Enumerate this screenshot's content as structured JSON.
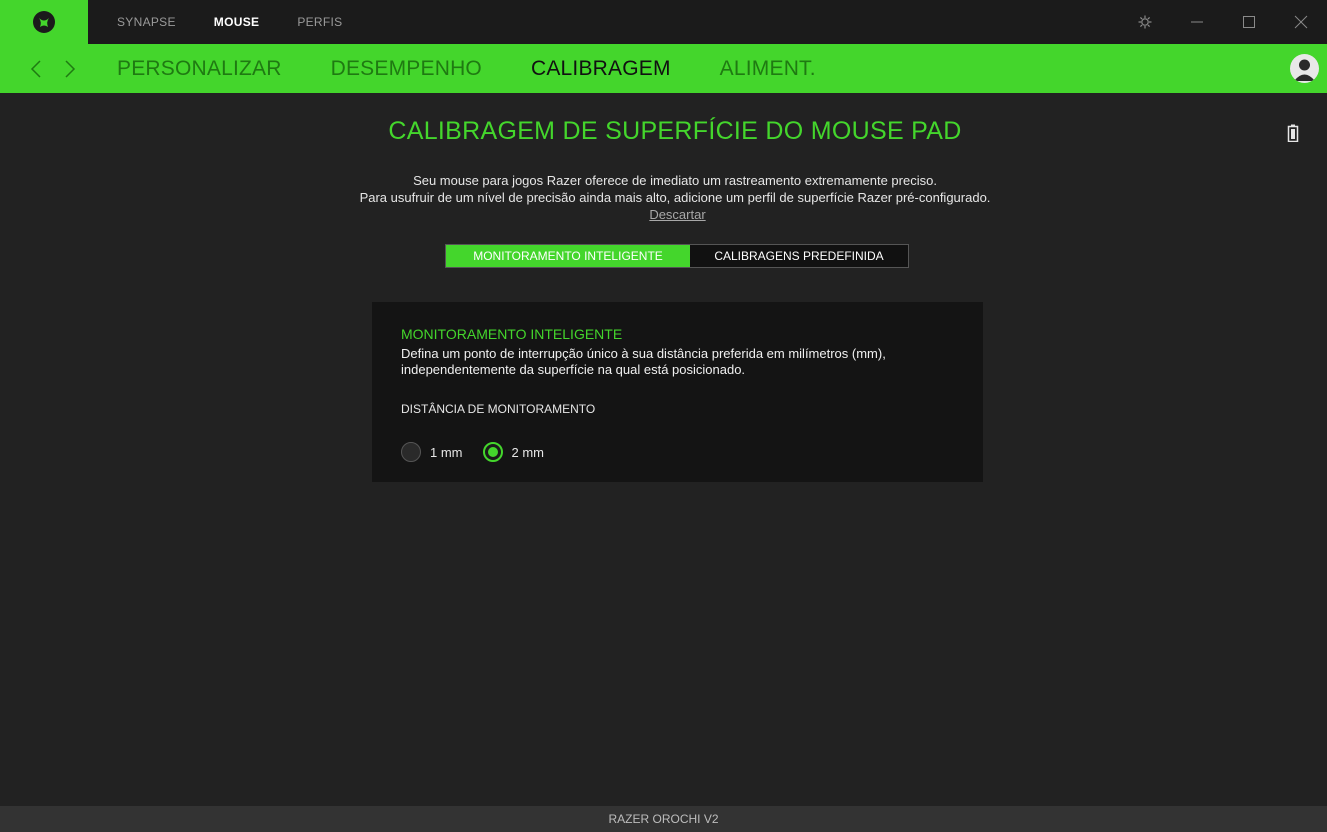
{
  "titlebar": {
    "tabs": [
      {
        "label": "SYNAPSE",
        "active": false
      },
      {
        "label": "MOUSE",
        "active": true
      },
      {
        "label": "PERFIS",
        "active": false
      }
    ],
    "icons": [
      "razer-logo-icon",
      "settings-icon",
      "minimize-icon",
      "maximize-icon",
      "close-icon"
    ]
  },
  "navbar": {
    "tabs": [
      {
        "label": "PERSONALIZAR",
        "active": false
      },
      {
        "label": "DESEMPENHO",
        "active": false
      },
      {
        "label": "CALIBRAGEM",
        "active": true
      },
      {
        "label": "ALIMENT.",
        "active": false
      }
    ]
  },
  "main": {
    "title": "CALIBRAGEM DE SUPERFÍCIE DO MOUSE PAD",
    "description_line1": "Seu mouse para jogos Razer oferece de imediato um rastreamento extremamente preciso.",
    "description_line2": "Para usufruir de um nível de precisão ainda mais alto, adicione um perfil de superfície Razer pré-configurado.",
    "dismiss_link": "Descartar",
    "mode_toggle": {
      "selected": "MONITORAMENTO INTELIGENTE",
      "options": [
        "MONITORAMENTO INTELIGENTE",
        "CALIBRAGENS PREDEFINIDA"
      ]
    },
    "panel": {
      "title": "MONITORAMENTO INTELIGENTE",
      "description": "Defina um ponto de interrupção único à sua distância preferida em milímetros (mm), independentemente da superfície na qual está posicionado.",
      "distance_label": "DISTÂNCIA DE MONITORAMENTO",
      "options": [
        {
          "label": "1 mm",
          "selected": false
        },
        {
          "label": "2 mm",
          "selected": true
        }
      ]
    }
  },
  "footer": {
    "device_name": "RAZER OROCHI V2"
  },
  "colors": {
    "accent": "#44d62c",
    "background": "#222222",
    "titlebar": "#1b1b1b",
    "panel": "#141414",
    "footer": "#333333"
  }
}
